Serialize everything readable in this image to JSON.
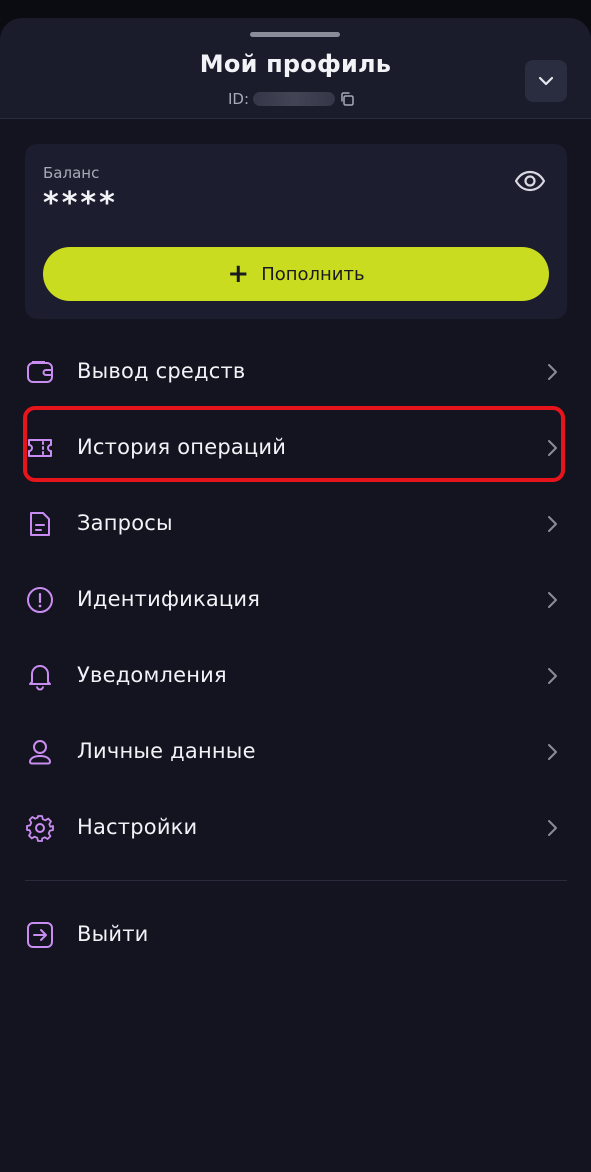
{
  "header": {
    "title": "Мой профиль",
    "id_label": "ID:",
    "id_value_hidden": true
  },
  "balance": {
    "label": "Баланс",
    "value": "****",
    "topup_label": "Пополнить"
  },
  "menu": [
    {
      "label": "Вывод средств",
      "icon": "wallet-icon"
    },
    {
      "label": "История операций",
      "icon": "ticket-icon",
      "highlighted": true
    },
    {
      "label": "Запросы",
      "icon": "document-icon"
    },
    {
      "label": "Идентификация",
      "icon": "alert-circle-icon"
    },
    {
      "label": "Уведомления",
      "icon": "bell-icon"
    },
    {
      "label": "Личные данные",
      "icon": "user-icon"
    },
    {
      "label": "Настройки",
      "icon": "gear-icon"
    }
  ],
  "logout": {
    "label": "Выйти",
    "icon": "logout-icon"
  },
  "colors": {
    "accent": "#c9dc20",
    "icon": "#c98cf0",
    "highlight": "#e8141b",
    "background": "#13141f"
  }
}
